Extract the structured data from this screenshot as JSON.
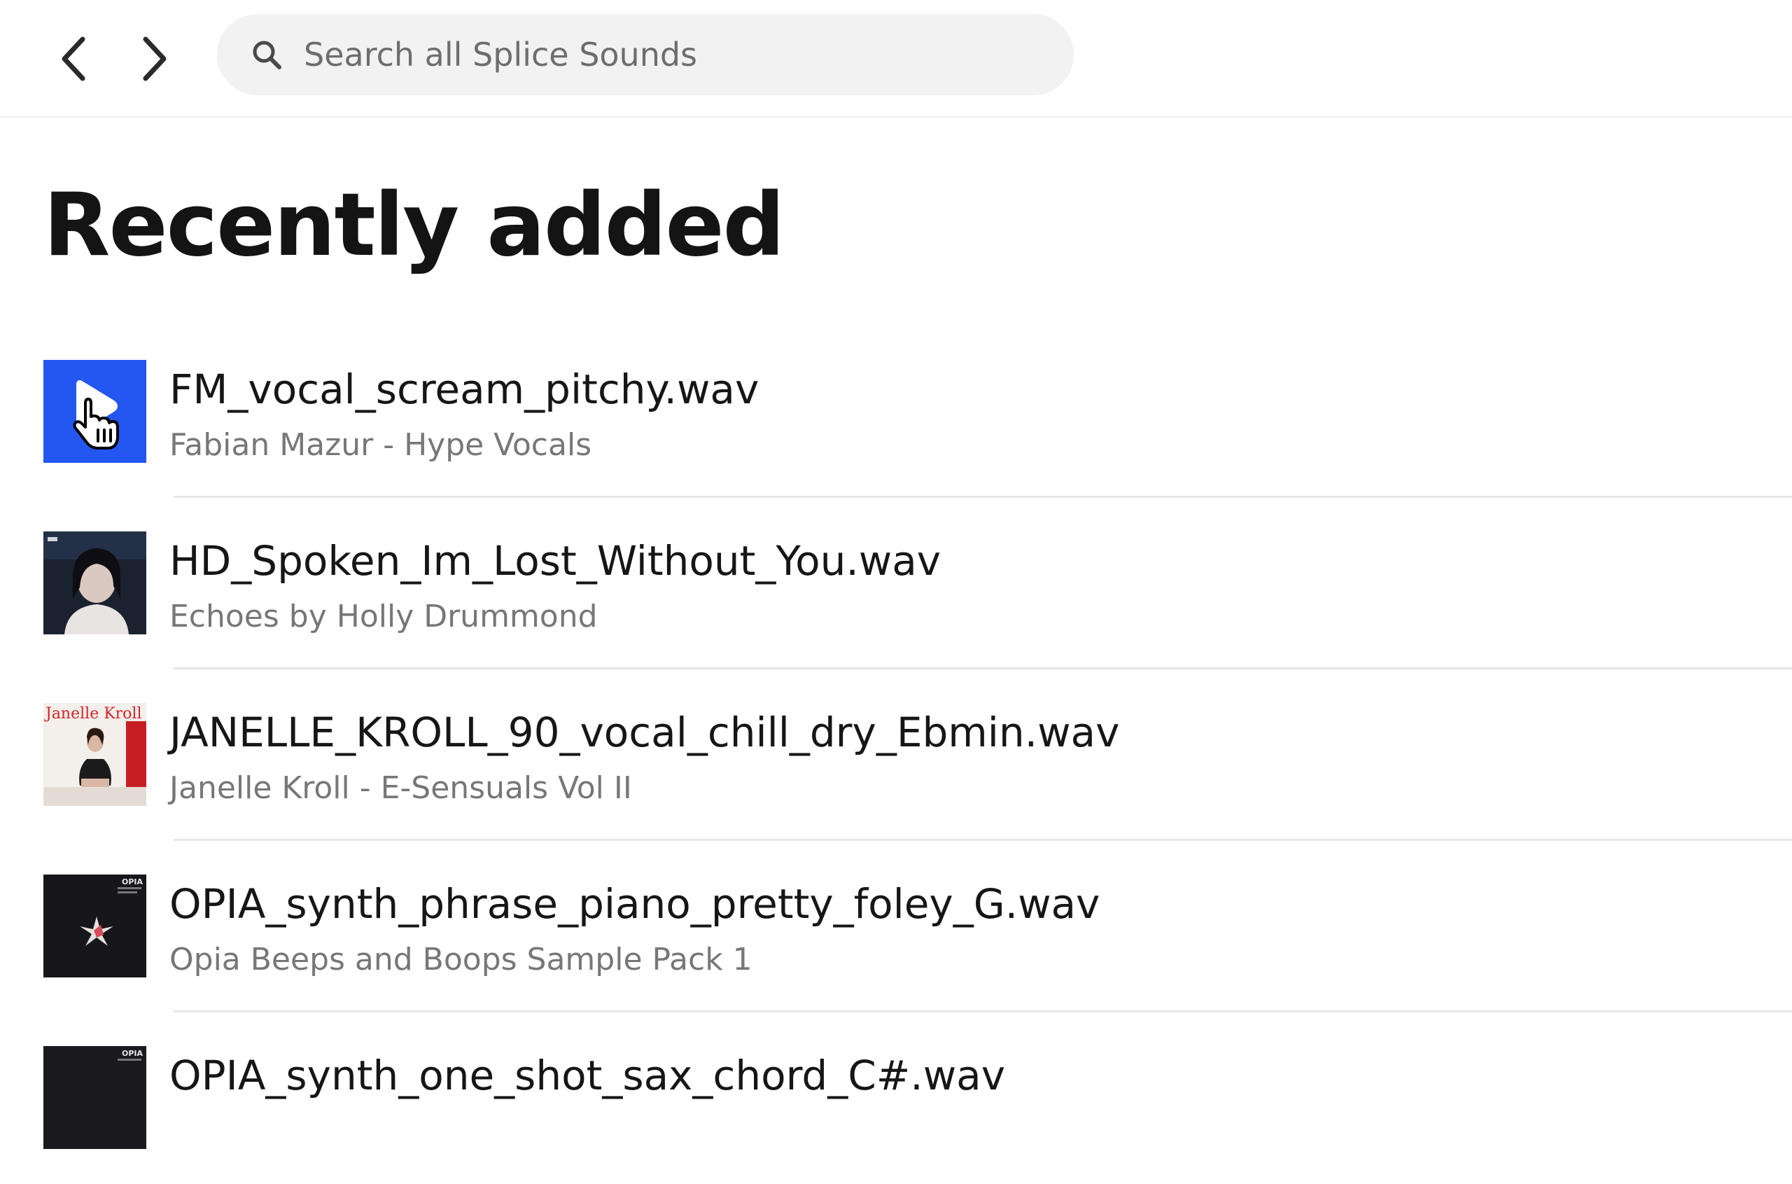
{
  "search": {
    "placeholder": "Search all Splice Sounds"
  },
  "page": {
    "title": "Recently added"
  },
  "items": [
    {
      "title": "FM_vocal_scream_pitchy.wav",
      "subtitle": "Fabian Mazur - Hype Vocals",
      "thumb_color": "#2456f0",
      "state": "hovered-playing"
    },
    {
      "title": "HD_Spoken_Im_Lost_Without_You.wav",
      "subtitle": "Echoes by Holly Drummond"
    },
    {
      "title": "JANELLE_KROLL_90_vocal_chill_dry_Ebmin.wav",
      "subtitle": "Janelle Kroll - E-Sensuals Vol II",
      "cover_text": "Janelle Kroll"
    },
    {
      "title": "OPIA_synth_phrase_piano_pretty_foley_G.wav",
      "subtitle": "Opia Beeps and Boops Sample Pack 1",
      "cover_text": "OPIA"
    },
    {
      "title": "OPIA_synth_one_shot_sax_chord_C#.wav",
      "subtitle": "",
      "cover_text": "OPIA"
    }
  ],
  "colors": {
    "accent": "#2456f0",
    "text_primary": "#161616",
    "text_secondary": "#777777",
    "search_bg": "#f2f2f2"
  },
  "icons": {
    "back": "chevron-left-icon",
    "forward": "chevron-right-icon",
    "search": "search-icon",
    "cursor": "hand-cursor-icon",
    "play": "play-icon"
  }
}
